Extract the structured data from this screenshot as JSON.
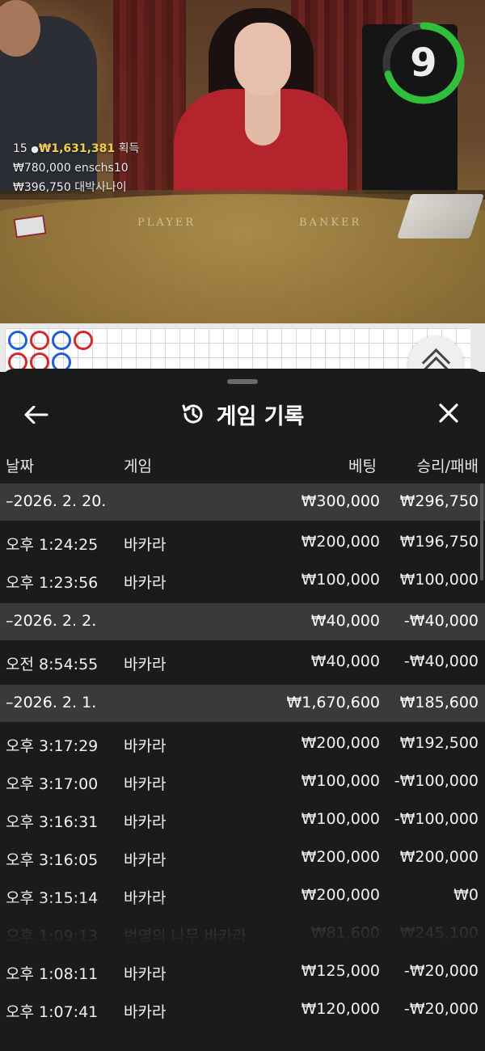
{
  "video": {
    "timer": "9",
    "timer_progress": 0.7,
    "felt_labels": [
      "PLAYER",
      "BANKER"
    ],
    "winners": {
      "count": "15",
      "total": "₩1,631,381",
      "total_suffix": "획득",
      "rows": [
        {
          "amount": "₩780,000",
          "name": "enschs10"
        },
        {
          "amount": "₩396,750",
          "name": "대박사나이"
        }
      ]
    }
  },
  "roadmap": {
    "beads_row1": [
      "blue",
      "red",
      "blue",
      "red"
    ],
    "beads_row2": [
      "red",
      "red",
      "blue"
    ]
  },
  "sheet": {
    "title": "게임 기록",
    "columns": {
      "date": "날짜",
      "game": "게임",
      "bet": "베팅",
      "result": "승리/패배"
    },
    "groups": [
      {
        "date": "–2026. 2. 20.",
        "bet": "₩300,000",
        "result": "₩296,750",
        "items": [
          {
            "time": "오후 1:24:25",
            "game": "바카라",
            "bet": "₩200,000",
            "result": "₩196,750"
          },
          {
            "time": "오후 1:23:56",
            "game": "바카라",
            "bet": "₩100,000",
            "result": "₩100,000"
          }
        ]
      },
      {
        "date": "–2026. 2. 2.",
        "bet": "₩40,000",
        "result": "-₩40,000",
        "items": [
          {
            "time": "오전 8:54:55",
            "game": "바카라",
            "bet": "₩40,000",
            "result": "-₩40,000"
          }
        ]
      },
      {
        "date": "–2026. 2. 1.",
        "bet": "₩1,670,600",
        "result": "₩185,600",
        "items": [
          {
            "time": "오후 3:17:29",
            "game": "바카라",
            "bet": "₩200,000",
            "result": "₩192,500"
          },
          {
            "time": "오후 3:17:00",
            "game": "바카라",
            "bet": "₩100,000",
            "result": "-₩100,000"
          },
          {
            "time": "오후 3:16:31",
            "game": "바카라",
            "bet": "₩100,000",
            "result": "-₩100,000"
          },
          {
            "time": "오후 3:16:05",
            "game": "바카라",
            "bet": "₩200,000",
            "result": "₩200,000"
          },
          {
            "time": "오후 3:15:14",
            "game": "바카라",
            "bet": "₩200,000",
            "result": "₩0"
          },
          {
            "time": "오후 1:09:13",
            "game": "번영의 나무 바카라",
            "bet": "₩81,600",
            "result": "₩245,100"
          },
          {
            "time": "오후 1:08:11",
            "game": "바카라",
            "bet": "₩125,000",
            "result": "-₩20,000"
          },
          {
            "time": "오후 1:07:41",
            "game": "바카라",
            "bet": "₩120,000",
            "result": "-₩20,000"
          }
        ]
      }
    ]
  },
  "colors": {
    "sheet_bg": "#1b1b1b",
    "group_bg": "#3a3a3c",
    "timer_green": "#2fbf3b",
    "winner_gold": "#f0cf52",
    "bead_blue": "#1f5fd6",
    "bead_red": "#d02a2a"
  },
  "icons": {
    "back": "arrow-left-icon",
    "history": "history-clock-icon",
    "close": "close-icon",
    "expand": "chevron-up-double-icon"
  }
}
